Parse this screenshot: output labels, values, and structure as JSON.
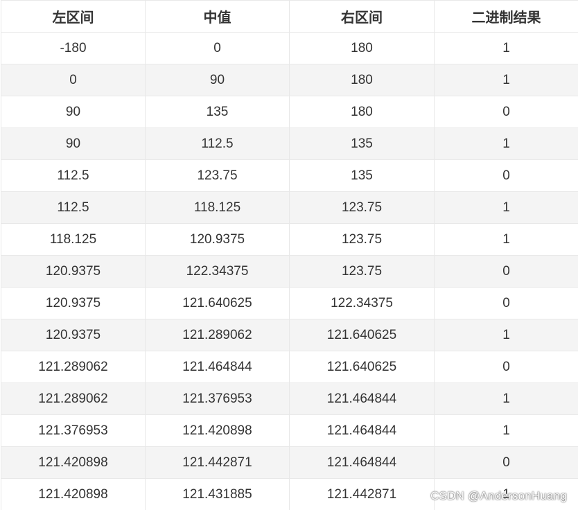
{
  "table": {
    "headers": [
      "左区间",
      "中值",
      "右区间",
      "二进制结果"
    ],
    "rows": [
      [
        "-180",
        "0",
        "180",
        "1"
      ],
      [
        "0",
        "90",
        "180",
        "1"
      ],
      [
        "90",
        "135",
        "180",
        "0"
      ],
      [
        "90",
        "112.5",
        "135",
        "1"
      ],
      [
        "112.5",
        "123.75",
        "135",
        "0"
      ],
      [
        "112.5",
        "118.125",
        "123.75",
        "1"
      ],
      [
        "118.125",
        "120.9375",
        "123.75",
        "1"
      ],
      [
        "120.9375",
        "122.34375",
        "123.75",
        "0"
      ],
      [
        "120.9375",
        "121.640625",
        "122.34375",
        "0"
      ],
      [
        "120.9375",
        "121.289062",
        "121.640625",
        "1"
      ],
      [
        "121.289062",
        "121.464844",
        "121.640625",
        "0"
      ],
      [
        "121.289062",
        "121.376953",
        "121.464844",
        "1"
      ],
      [
        "121.376953",
        "121.420898",
        "121.464844",
        "1"
      ],
      [
        "121.420898",
        "121.442871",
        "121.464844",
        "0"
      ],
      [
        "121.420898",
        "121.431885",
        "121.442871",
        "1"
      ]
    ]
  },
  "watermark": "CSDN @AndersonHuang",
  "colors": {
    "text": "#333333",
    "stripe": "#f4f4f4",
    "border": "#e8e8e8"
  }
}
